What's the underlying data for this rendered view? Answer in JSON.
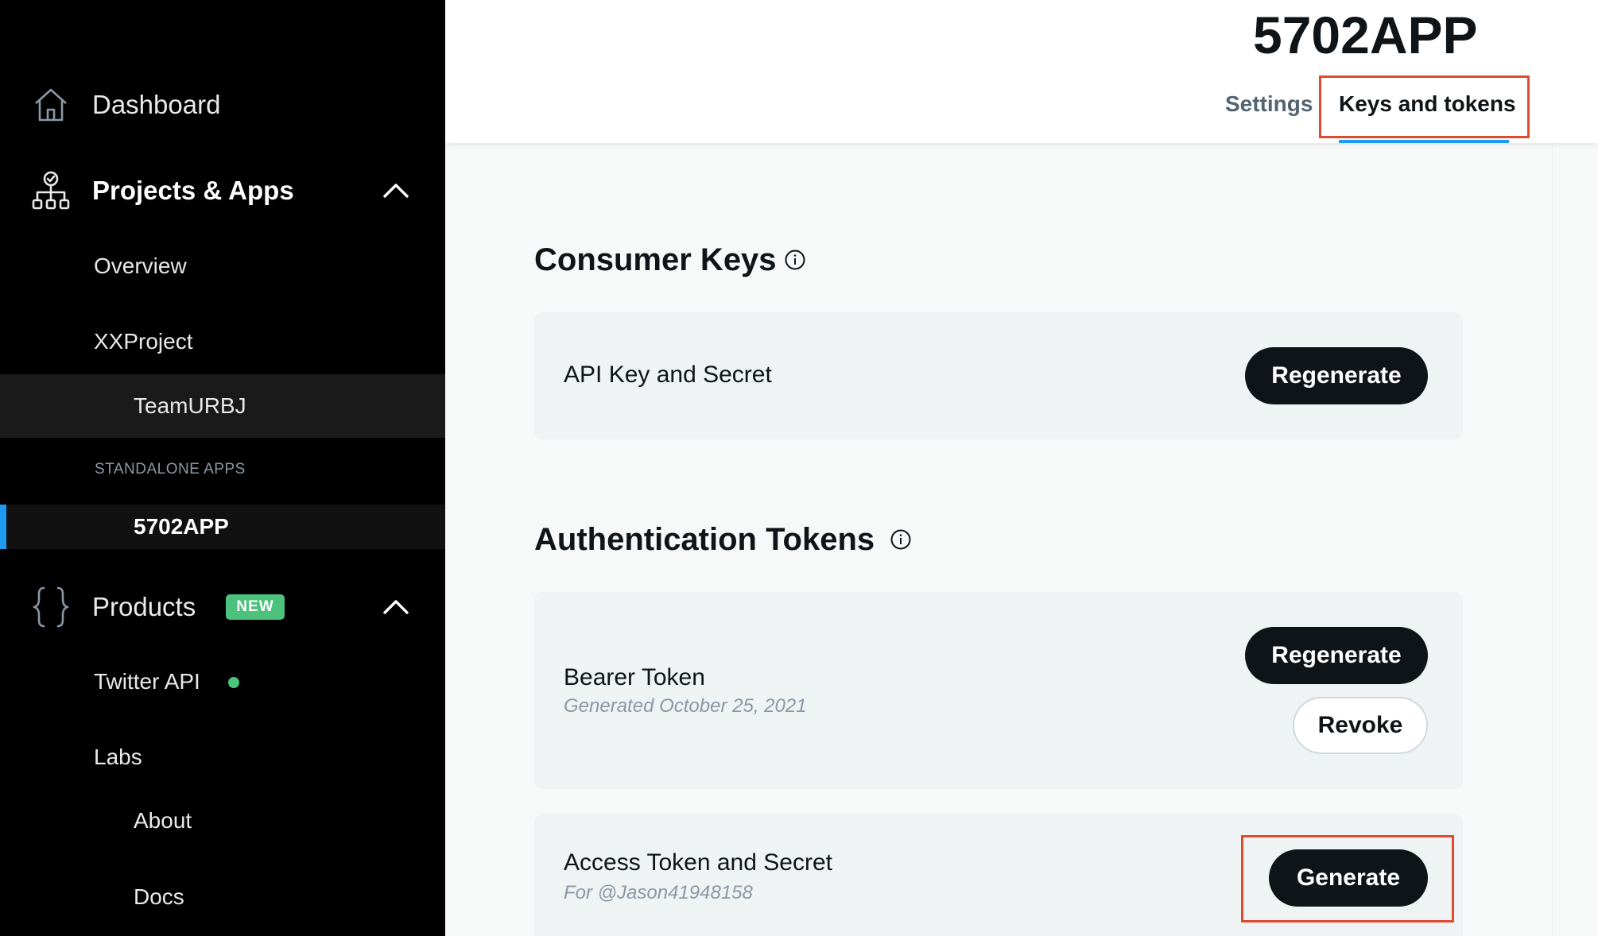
{
  "sidebar": {
    "dashboard": {
      "label": "Dashboard",
      "icon": "home-icon"
    },
    "projects": {
      "label": "Projects & Apps",
      "icon": "sitemap-icon",
      "chevron": "chevron-up-icon"
    },
    "overview": {
      "label": "Overview"
    },
    "project": {
      "label": "XXProject"
    },
    "team": {
      "label": "TeamURBJ"
    },
    "standalone_label": "STANDALONE APPS",
    "app": {
      "label": "5702APP"
    },
    "products": {
      "label": "Products",
      "badge": "NEW",
      "icon": "braces-icon",
      "chevron": "chevron-up-icon"
    },
    "twitter_api": {
      "label": "Twitter API",
      "status_color": "#4cc27d"
    },
    "labs": {
      "label": "Labs"
    },
    "about": {
      "label": "About"
    },
    "docs": {
      "label": "Docs"
    }
  },
  "header": {
    "title": "5702APP",
    "tabs": [
      {
        "label": "Settings",
        "active": false
      },
      {
        "label": "Keys and tokens",
        "active": true
      }
    ]
  },
  "main": {
    "consumer_keys": {
      "heading": "Consumer Keys",
      "item": {
        "title": "API Key and Secret",
        "button": "Regenerate"
      }
    },
    "auth_tokens": {
      "heading": "Authentication Tokens",
      "bearer": {
        "title": "Bearer Token",
        "subtitle": "Generated October 25, 2021",
        "primary_button": "Regenerate",
        "secondary_button": "Revoke"
      },
      "access": {
        "title": "Access Token and Secret",
        "subtitle": "For @Jason41948158",
        "button": "Generate"
      }
    }
  },
  "colors": {
    "accent": "#1d9bf0",
    "highlight_box": "#e04a2f",
    "new_badge": "#4cc27d",
    "sidebar_bg": "#000000"
  }
}
